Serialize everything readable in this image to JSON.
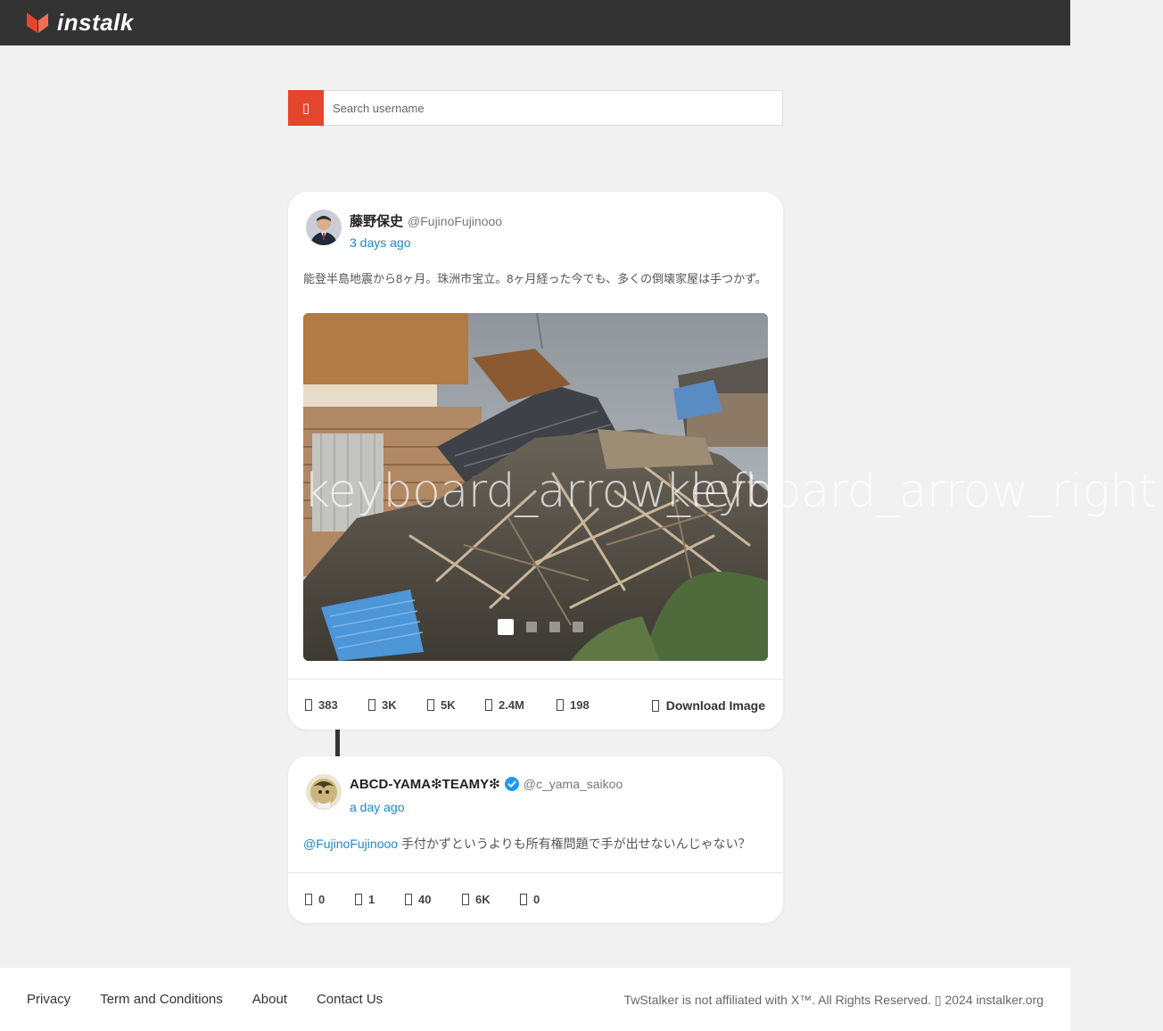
{
  "header": {
    "logo_text": "instalk",
    "colors": {
      "bar": "#333333",
      "accent": "#e4452d"
    }
  },
  "search": {
    "placeholder": "Search username",
    "icon": "search-icon",
    "icon_glyph": "▯"
  },
  "posts": [
    {
      "display_name": "藤野保史",
      "handle": "@FujinoFujinooo",
      "time": "3 days ago",
      "text": "能登半島地震から8ヶ月。珠洲市宝立。8ヶ月経った今でも、多くの倒壊家屋は手つかず。",
      "carousel": {
        "count": 4,
        "active": 1
      },
      "stats": [
        {
          "icon": "reply-icon",
          "value": "383"
        },
        {
          "icon": "retweet-icon",
          "value": "3K"
        },
        {
          "icon": "like-icon",
          "value": "5K"
        },
        {
          "icon": "views-icon",
          "value": "2.4M"
        },
        {
          "icon": "bookmark-icon",
          "value": "198"
        }
      ],
      "download_label": "Download Image"
    },
    {
      "display_name": "ABCD-YAMA❇TEAMY❇",
      "verified": true,
      "handle": "@c_yama_saikoo",
      "time": "a day ago",
      "mention": "@FujinoFujinooo",
      "text": "手付かずというよりも所有権問題で手が出せないんじゃない？",
      "stats": [
        {
          "icon": "reply-icon",
          "value": "0"
        },
        {
          "icon": "retweet-icon",
          "value": "1"
        },
        {
          "icon": "like-icon",
          "value": "40"
        },
        {
          "icon": "views-icon",
          "value": "6K"
        },
        {
          "icon": "bookmark-icon",
          "value": "0"
        }
      ]
    }
  ],
  "overlay": {
    "arrow_left": "keyboard_arrow_left",
    "arrow_right": "keyboard_arrow_right"
  },
  "footer": {
    "links": [
      "Privacy",
      "Term and Conditions",
      "About",
      "Contact Us"
    ],
    "copyright": "TwStalker is not affiliated with X™. All Rights Reserved. ▯ 2024 instalker.org"
  }
}
